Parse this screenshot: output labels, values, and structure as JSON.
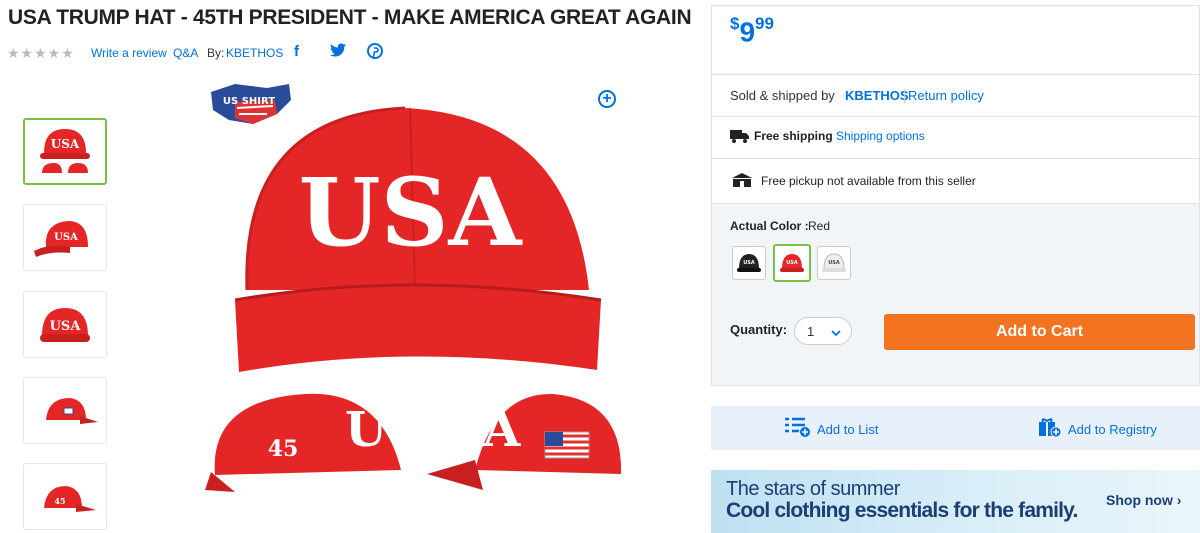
{
  "product": {
    "title": "USA TRUMP HAT - 45TH PRESIDENT - MAKE AMERICA GREAT AGAIN",
    "stars": "★★★★★",
    "write_review": "Write a review",
    "qa": "Q&A",
    "by_label": "By:",
    "brand": "KBETHOS",
    "hat_text": "USA",
    "side_number": "45",
    "logo_text": "US SHIRT"
  },
  "buy": {
    "price_symbol": "$",
    "price_whole": "9",
    "price_cents": "99",
    "sold_by_label": "Sold & shipped by",
    "seller": "KBETHOS",
    "return_policy": "Return policy",
    "free_shipping": "Free shipping",
    "shipping_options": "Shipping options",
    "pickup": "Free pickup not available from this seller",
    "color_label": "Actual Color :",
    "color_value": "Red",
    "swatches": [
      "USA",
      "USA",
      "USA"
    ],
    "quantity_label": "Quantity:",
    "quantity_value": "1",
    "add_to_cart": "Add to Cart",
    "add_to_list": "Add to List",
    "add_to_registry": "Add to Registry"
  },
  "banner": {
    "line1": "The stars of summer",
    "line2": "Cool clothing essentials for the family.",
    "cta": "Shop now ›"
  },
  "colors": {
    "accent": "#0071dc",
    "cart": "#f47321",
    "hat_red": "#e42627",
    "selected": "#76c043"
  }
}
